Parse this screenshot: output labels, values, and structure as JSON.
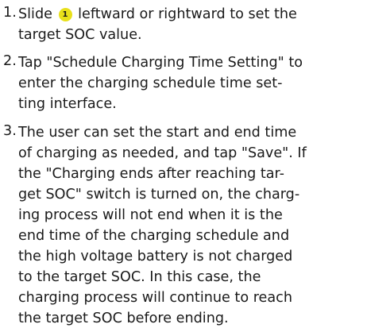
{
  "steps": [
    {
      "number": "1.",
      "lines": [
        "Slide",
        "leftward or rightward to set the",
        "target SOC value."
      ],
      "callout": "1"
    },
    {
      "number": "2.",
      "lines": [
        "Tap \"Schedule Charging Time Setting\" to",
        "enter the charging schedule time set-",
        "ting interface."
      ]
    },
    {
      "number": "3.",
      "lines": [
        "The user can set the start and end time",
        "of charging as needed, and tap \"Save\". If",
        "the \"Charging ends after reaching tar-",
        "get SOC\" switch is turned on, the charg-",
        "ing process will not end when it is the",
        "end time of the charging schedule and",
        "the high voltage battery is not charged",
        "to the target SOC. In this case, the",
        "charging process will continue to reach",
        "the target SOC before ending."
      ]
    }
  ]
}
